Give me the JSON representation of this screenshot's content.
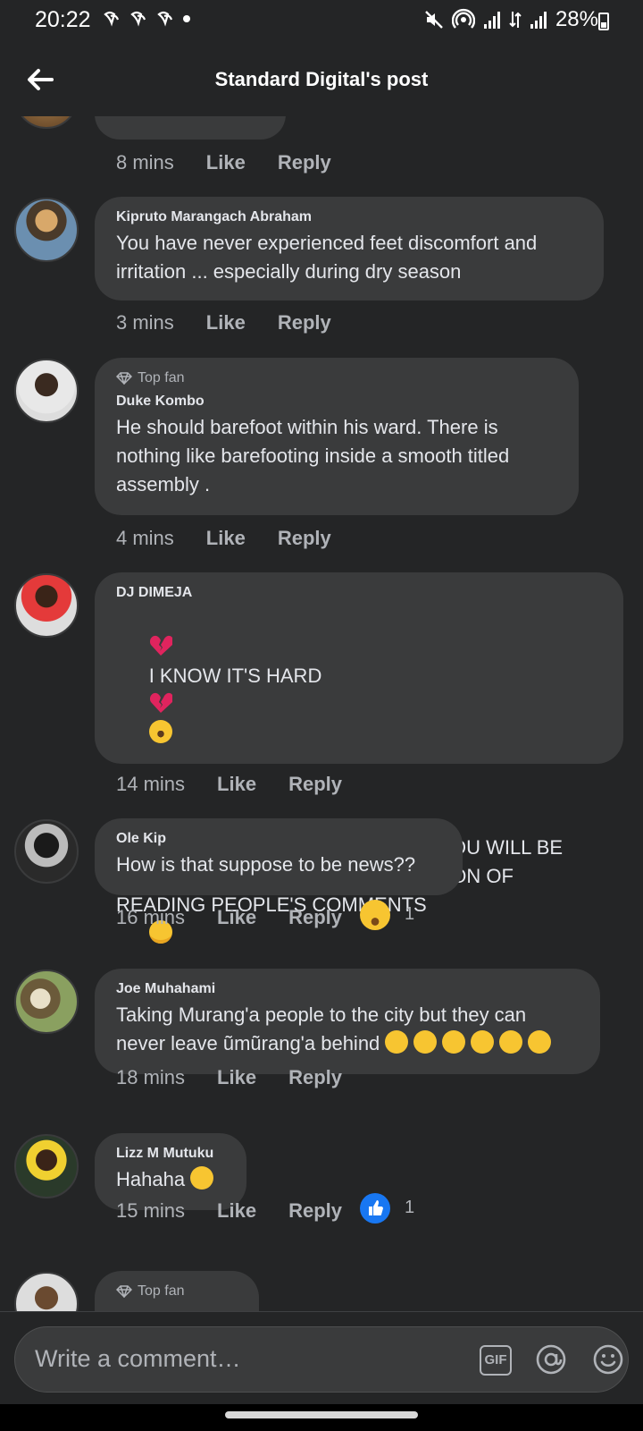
{
  "status_bar": {
    "time": "20:22",
    "battery": "28%"
  },
  "header": {
    "title": "Standard Digital's post"
  },
  "partial_comment": {
    "time": "8 mins",
    "like": "Like",
    "reply": "Reply"
  },
  "comments": [
    {
      "name": "Kipruto Marangach Abraham",
      "text": "You have never experienced feet discomfort and irritation ... especially during dry season",
      "time": "3 mins",
      "like": "Like",
      "reply": "Reply"
    },
    {
      "badge": "Top fan",
      "name": "Duke Kombo",
      "text": "He should barefoot within his ward. There is nothing like barefooting inside a smooth titled assembly .",
      "time": "4 mins",
      "like": "Like",
      "reply": "Reply"
    },
    {
      "name": "DJ DIMEJA",
      "text_line1": "I KNOW IT'S HARD",
      "text_line2": "BUT I BELIEVE THAT ONE DAY YOU WILL BE ABLE TO OVERCOME THIS ADDICTION OF READING PEOPLE'S COMMENTS",
      "time": "14 mins",
      "like": "Like",
      "reply": "Reply"
    },
    {
      "name": "Ole Kip",
      "text": "How is that suppose to be news??",
      "time": "16 mins",
      "like": "Like",
      "reply": "Reply",
      "reaction_count": "1"
    },
    {
      "name": "Joe Muhahami",
      "text": "Taking Murang'a people to the city but they can never leave ũmũrang'a behind",
      "time": "18 mins",
      "like": "Like",
      "reply": "Reply"
    },
    {
      "name": "Lizz M Mutuku",
      "text": "Hahaha",
      "time": "15 mins",
      "like": "Like",
      "reply": "Reply",
      "reaction_count": "1"
    },
    {
      "badge": "Top fan"
    }
  ],
  "composer": {
    "placeholder": "Write a comment…",
    "gif_label": "GIF"
  },
  "colors": {
    "background": "#242526",
    "bubble": "#3a3b3c",
    "text": "#e4e6eb",
    "secondary_text": "#b0b3b8",
    "like_blue": "#1877f2"
  }
}
